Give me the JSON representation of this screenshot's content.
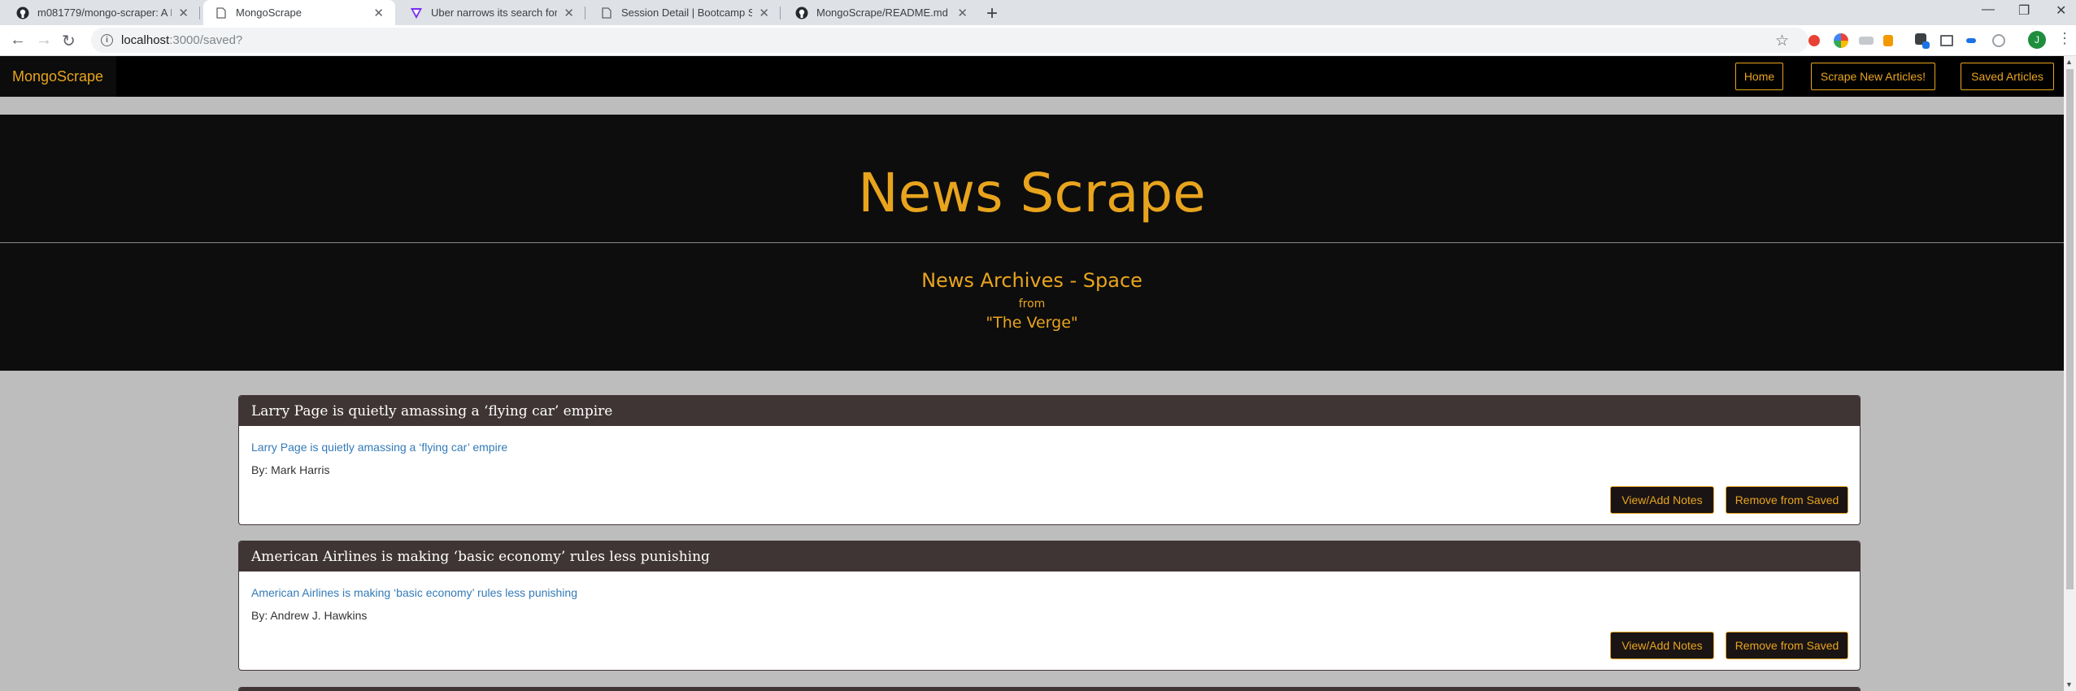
{
  "browser": {
    "tabs": [
      {
        "title": "m081779/mongo-scraper: A NYT",
        "icon": "github-icon"
      },
      {
        "title": "MongoScrape",
        "icon": "page-icon"
      },
      {
        "title": "Uber narrows its search for inter",
        "icon": "verge-icon"
      },
      {
        "title": "Session Detail | Bootcamp Spot",
        "icon": "page-icon"
      },
      {
        "title": "MongoScrape/README.md at m",
        "icon": "github-icon"
      }
    ],
    "url_host": "localhost",
    "url_path": ":3000/saved?",
    "profile_initial": "J"
  },
  "navbar": {
    "brand": "MongoScrape",
    "home": "Home",
    "scrape": "Scrape New Articles!",
    "saved": "Saved Articles"
  },
  "jumbotron": {
    "title": "News Scrape",
    "subtitle": "News Archives - Space",
    "from": "from",
    "source": "\"The Verge\""
  },
  "articles": [
    {
      "headline": "Larry Page is quietly amassing a ‘flying car’ empire",
      "link": "Larry Page is quietly amassing a ‘flying car’ empire",
      "byline": "By: Mark Harris",
      "notes_label": "View/Add Notes",
      "remove_label": "Remove from Saved"
    },
    {
      "headline": "American Airlines is making ‘basic economy’ rules less punishing",
      "link": "American Airlines is making ‘basic economy’ rules less punishing",
      "byline": "By: Andrew J. Hawkins",
      "notes_label": "View/Add Notes",
      "remove_label": "Remove from Saved"
    }
  ],
  "colors": {
    "accent": "#e8a41d",
    "card_header": "#3f3534",
    "link": "#337ab7"
  }
}
